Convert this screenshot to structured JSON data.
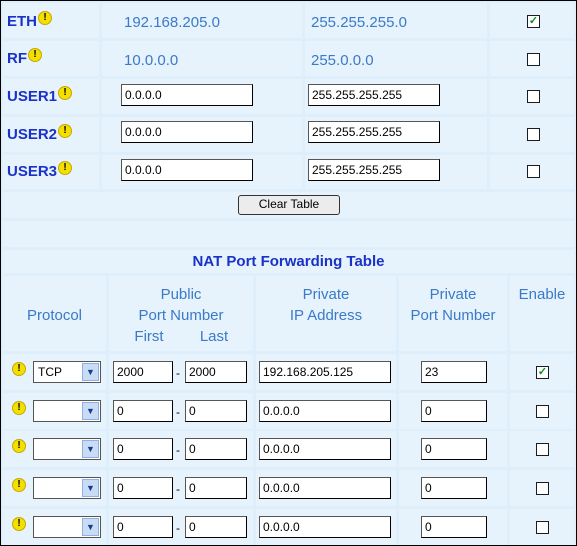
{
  "warning_glyph": "!",
  "check_glyph": "✓",
  "hosts": [
    {
      "label": "ETH",
      "address": "192.168.205.0",
      "mask": "255.255.255.0",
      "editable": false,
      "checked": true
    },
    {
      "label": "RF",
      "address": "10.0.0.0",
      "mask": "255.0.0.0",
      "editable": false,
      "checked": false
    },
    {
      "label": "USER1",
      "address": "0.0.0.0",
      "mask": "255.255.255.255",
      "editable": true,
      "checked": false
    },
    {
      "label": "USER2",
      "address": "0.0.0.0",
      "mask": "255.255.255.255",
      "editable": true,
      "checked": false
    },
    {
      "label": "USER3",
      "address": "0.0.0.0",
      "mask": "255.255.255.255",
      "editable": true,
      "checked": false
    }
  ],
  "clear_button_label": "Clear Table",
  "nat": {
    "title": "NAT Port Forwarding Table",
    "headers": {
      "protocol": "Protocol",
      "public_line1": "Public",
      "public_line2": "Port Number",
      "first": "First",
      "last": "Last",
      "private_ip_line1": "Private",
      "private_ip_line2": "IP Address",
      "private_port_line1": "Private",
      "private_port_line2": "Port Number",
      "enable": "Enable"
    },
    "rows": [
      {
        "protocol": "TCP",
        "first": "2000",
        "last": "2000",
        "ip": "192.168.205.125",
        "port": "23",
        "enabled": true
      },
      {
        "protocol": "",
        "first": "0",
        "last": "0",
        "ip": "0.0.0.0",
        "port": "0",
        "enabled": false
      },
      {
        "protocol": "",
        "first": "0",
        "last": "0",
        "ip": "0.0.0.0",
        "port": "0",
        "enabled": false
      },
      {
        "protocol": "",
        "first": "0",
        "last": "0",
        "ip": "0.0.0.0",
        "port": "0",
        "enabled": false
      },
      {
        "protocol": "",
        "first": "0",
        "last": "0",
        "ip": "0.0.0.0",
        "port": "0",
        "enabled": false
      }
    ],
    "dash": "-"
  },
  "colors": {
    "label_blue": "#1a32c8",
    "value_blue": "#3a7ac8",
    "background": "#dfeefb",
    "cell": "#e6f2fc",
    "warning_yellow": "#f4e000",
    "check_green": "#118a1a"
  }
}
